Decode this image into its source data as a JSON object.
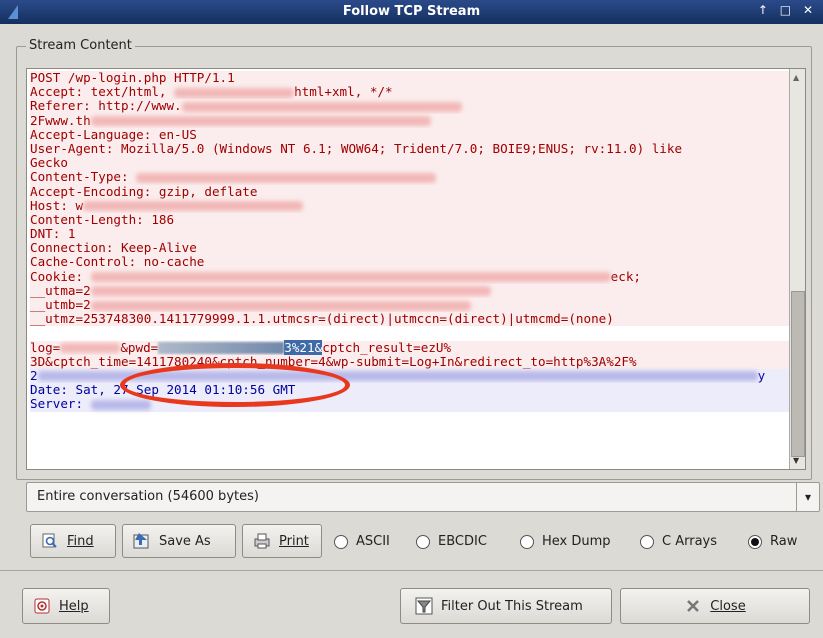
{
  "window": {
    "title": "Follow TCP Stream",
    "controls": "↑ □ ✕"
  },
  "group_label": "Stream Content",
  "stream_lines": [
    {
      "type": "req",
      "text": "POST /wp-login.php HTTP/1.1"
    },
    {
      "type": "req",
      "text": "Accept: text/html, ",
      "tail": "html+xml, */*"
    },
    {
      "type": "req",
      "text": "Referer: http://www."
    },
    {
      "type": "req",
      "text": "2Fwww.th"
    },
    {
      "type": "req",
      "text": "Accept-Language: en-US"
    },
    {
      "type": "req",
      "text": "User-Agent: Mozilla/5.0 (Windows NT 6.1; WOW64; Trident/7.0; BOIE9;ENUS; rv:11.0) like"
    },
    {
      "type": "req",
      "text": "Gecko"
    },
    {
      "type": "req",
      "text": "Content-Type: "
    },
    {
      "type": "req",
      "text": "Accept-Encoding: gzip, deflate"
    },
    {
      "type": "req",
      "text": "Host: w"
    },
    {
      "type": "req",
      "text": "Content-Length: 186"
    },
    {
      "type": "req",
      "text": "DNT: 1"
    },
    {
      "type": "req",
      "text": "Connection: Keep-Alive"
    },
    {
      "type": "req",
      "text": "Cache-Control: no-cache"
    },
    {
      "type": "req",
      "text": "Cookie: ",
      "tail": "eck;"
    },
    {
      "type": "req",
      "text": "__utma=2"
    },
    {
      "type": "req",
      "text": "__utmb=2"
    },
    {
      "type": "req",
      "text": "__utmz=253748300.1411779999.1.1.utmcsr=(direct)|utmccn=(direct)|utmcmd=(none)"
    },
    {
      "type": "blank",
      "text": ""
    },
    {
      "type": "req",
      "text": "log=",
      "mid": "&pwd=",
      "hl": "3%21&",
      "tail": "cptch_result=ezU%"
    },
    {
      "type": "req",
      "text": "3D&cptch_time=1411780240&cptch_number=4&wp-submit=Log+In&redirect_to=http%3A%2F%"
    },
    {
      "type": "resp",
      "text": "2",
      "tail": "y"
    },
    {
      "type": "resp",
      "text": "Date: Sat, 27 Sep 2014 01:10:56 GMT"
    },
    {
      "type": "resp",
      "text": "Server: "
    }
  ],
  "conversation_select": {
    "value": "Entire conversation (54600 bytes)"
  },
  "buttons": {
    "find": "Find",
    "save_as": "Save As",
    "print": "Print",
    "help": "Help",
    "filter_out": "Filter Out This Stream",
    "close": "Close"
  },
  "formats": [
    {
      "label": "ASCII",
      "selected": false
    },
    {
      "label": "EBCDIC",
      "selected": false
    },
    {
      "label": "Hex Dump",
      "selected": false
    },
    {
      "label": "C Arrays",
      "selected": false
    },
    {
      "label": "Raw",
      "selected": true
    }
  ],
  "colors": {
    "client_text": "#a00000",
    "server_text": "#0000a0",
    "annotation": "#e8391f"
  }
}
